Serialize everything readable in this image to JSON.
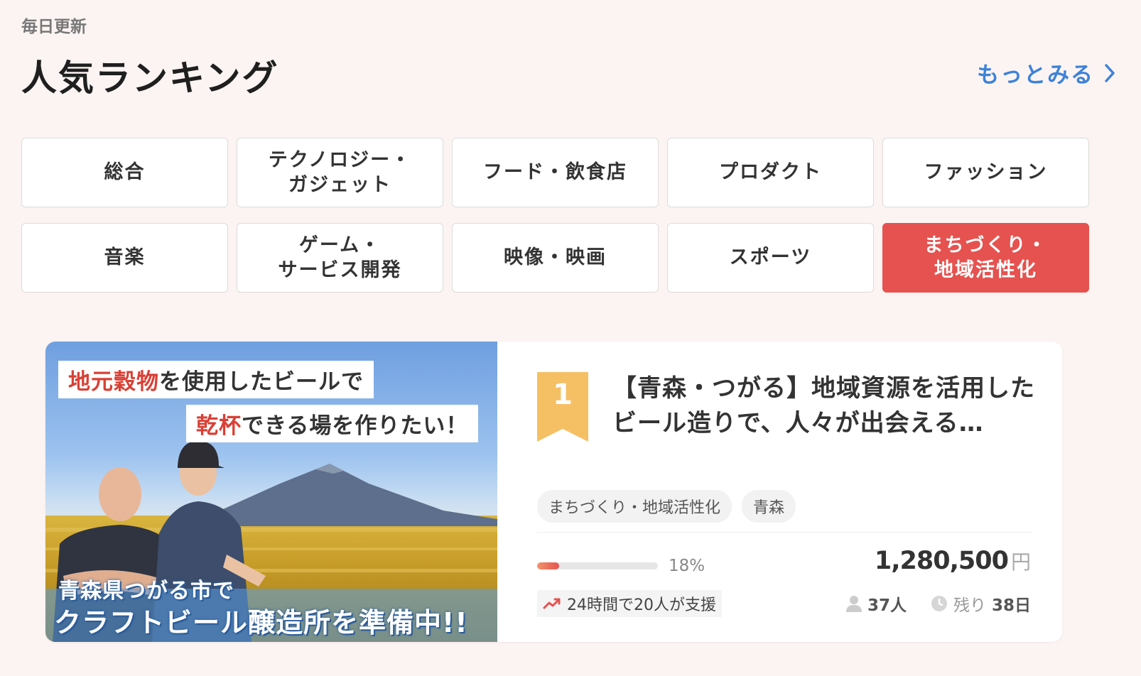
{
  "header": {
    "update_label": "毎日更新",
    "title": "人気ランキング",
    "more_link": "もっとみる"
  },
  "categories": [
    {
      "label": "総合",
      "active": false
    },
    {
      "label": "テクノロジー・\nガジェット",
      "active": false
    },
    {
      "label": "フード・飲食店",
      "active": false
    },
    {
      "label": "プロダクト",
      "active": false
    },
    {
      "label": "ファッション",
      "active": false
    },
    {
      "label": "音楽",
      "active": false
    },
    {
      "label": "ゲーム・\nサービス開発",
      "active": false
    },
    {
      "label": "映像・映画",
      "active": false
    },
    {
      "label": "スポーツ",
      "active": false
    },
    {
      "label": "まちづくり・\n地域活性化",
      "active": true
    }
  ],
  "colors": {
    "accent": "#e5524f",
    "link": "#3d82d9",
    "rank_badge": "#f5c064",
    "background": "#fcf4f2"
  },
  "project": {
    "rank": "1",
    "title": "【青森・つがる】地域資源を活用したビール造りで、人々が出会える…",
    "image_text": {
      "line1_red": "地元穀物",
      "line1_rest": "を使用したビールで",
      "line2_red": "乾杯",
      "line2_rest": "できる場を作りたい！",
      "line3": "青森県つがる市で",
      "line4": "クラフトビール醸造所を準備中!!"
    },
    "tags": [
      "まちづくり・地域活性化",
      "青森"
    ],
    "progress_fraction": 0.18,
    "progress_label": "18%",
    "amount": "1,280,500",
    "amount_unit": "円",
    "trend_text": "24時間で20人が支援",
    "supporters": "37人",
    "remaining_prefix": "残り",
    "remaining_days": "38日"
  }
}
